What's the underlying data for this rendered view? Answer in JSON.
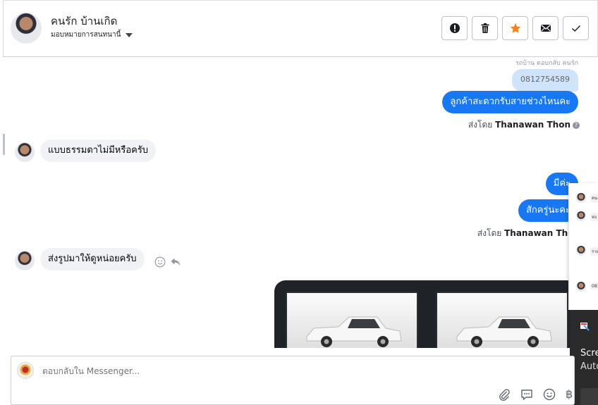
{
  "header": {
    "contact_name": "คนรัก บ้านเกิด",
    "assign_label": "มอบหมายการสนทนานี้",
    "actions": [
      "report-icon",
      "trash-icon",
      "star-icon",
      "envelope-icon",
      "check-icon"
    ]
  },
  "conversation": {
    "reply_note": "รถบ้าน ตอบกลับ คนรัก",
    "quoted_text": "0812754589",
    "messages": [
      {
        "dir": "out",
        "text": "ลูกค้าสะดวกรับสายช่วงไหนคะ"
      },
      {
        "dir": "in",
        "text": "แบบธรรมดาไม่มีหรือครับ"
      },
      {
        "dir": "out",
        "text": "มีค่ะ"
      },
      {
        "dir": "out",
        "text": "สักครู่นะคะ"
      },
      {
        "dir": "in",
        "text": "ส่งรูปมาให้ดูหน่อยครับ"
      }
    ],
    "sent_by_prefix": "ส่งโดย",
    "sent_by_name": "Thanawan Thon"
  },
  "overlay": {
    "items": [
      {
        "text": "คน"
      },
      {
        "text": "ห่ง"
      },
      {
        "text": "รายา"
      },
      {
        "text": "081"
      }
    ]
  },
  "screenshot_popup": {
    "line1": "Scre",
    "line2": "Auto"
  },
  "composer": {
    "placeholder": "ตอบกลับใน Messenger...",
    "tools": [
      "attachment-icon",
      "saved-replies-icon",
      "emoji-icon",
      "currency-icon"
    ],
    "currency_symbol": "฿"
  },
  "colors": {
    "accent": "#1877f2",
    "incoming_bubble": "#f0f2f5",
    "quoted_bubble": "#cfe3fb",
    "star": "#f5821f"
  }
}
